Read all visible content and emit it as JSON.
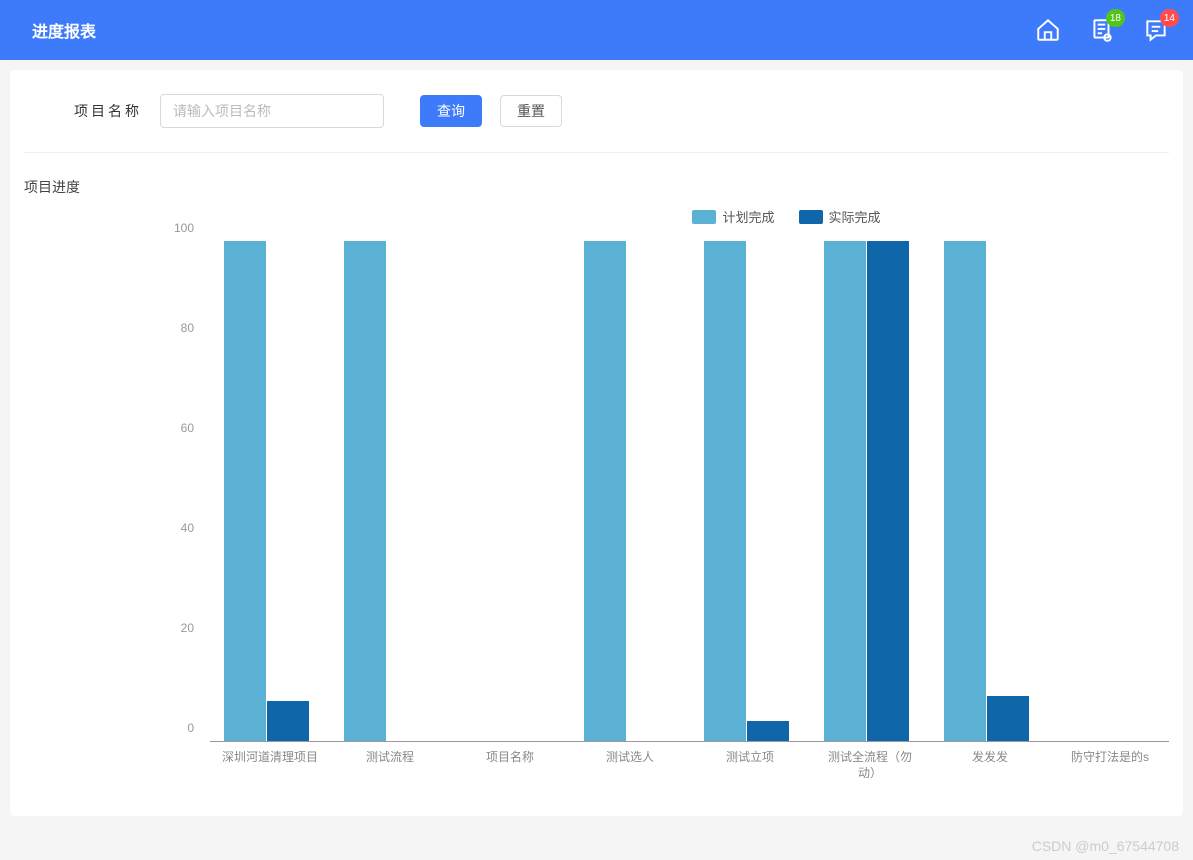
{
  "header": {
    "title": "进度报表",
    "badge_doc": "18",
    "badge_chat": "14"
  },
  "search": {
    "label": "项目名称",
    "placeholder": "请输入项目名称",
    "query_label": "查询",
    "reset_label": "重置"
  },
  "section_title": "项目进度",
  "colors": {
    "planned": "#5ab1d4",
    "actual": "#0f66a8"
  },
  "chart_data": {
    "type": "bar",
    "title": "",
    "xlabel": "",
    "ylabel": "",
    "ylim": [
      0,
      100
    ],
    "yticks": [
      0,
      20,
      40,
      60,
      80,
      100
    ],
    "legend": [
      "计划完成",
      "实际完成"
    ],
    "categories": [
      "深圳河道清理项目",
      "测试流程",
      "项目名称",
      "测试选人",
      "测试立项",
      "测试全流程（勿动）",
      "发发发",
      "防守打法是的s"
    ],
    "series": [
      {
        "name": "计划完成",
        "values": [
          100,
          100,
          0,
          100,
          100,
          100,
          100,
          0
        ]
      },
      {
        "name": "实际完成",
        "values": [
          8,
          0,
          0,
          0,
          4,
          100,
          9,
          0
        ]
      }
    ]
  },
  "watermark": "CSDN @m0_67544708"
}
